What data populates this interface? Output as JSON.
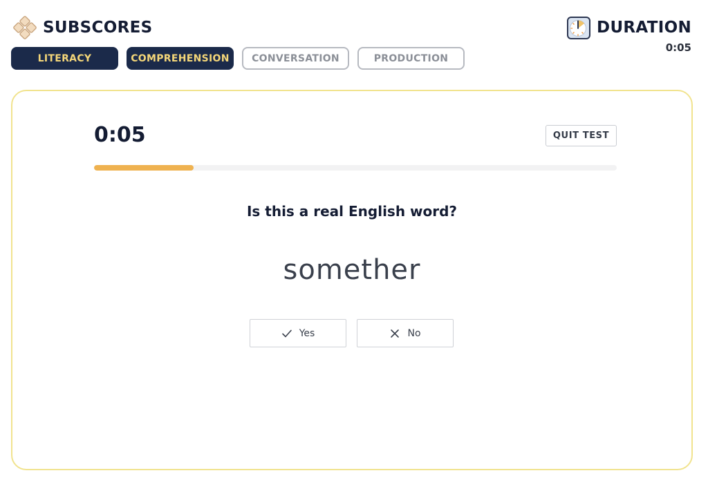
{
  "header": {
    "title": "SUBSCORES",
    "logo_icon": "diamond-grid-logo",
    "tabs": [
      {
        "label": "LITERACY",
        "active": true
      },
      {
        "label": "COMPREHENSION",
        "active": true
      },
      {
        "label": "CONVERSATION",
        "active": false
      },
      {
        "label": "PRODUCTION",
        "active": false
      }
    ]
  },
  "duration": {
    "title": "DURATION",
    "icon": "clock-icon",
    "value": "0:05"
  },
  "test": {
    "timer": "0:05",
    "quit_label": "QUIT TEST",
    "progress": 0.19,
    "question": "Is this a real English word?",
    "word": "somether",
    "answers": [
      {
        "label": "Yes",
        "icon": "check-icon"
      },
      {
        "label": "No",
        "icon": "x-icon"
      }
    ]
  },
  "colors": {
    "navy": "#1b2a4a",
    "accent_yellow": "#f5d779",
    "progress": "#efb250",
    "card_border": "#f1e38e"
  }
}
